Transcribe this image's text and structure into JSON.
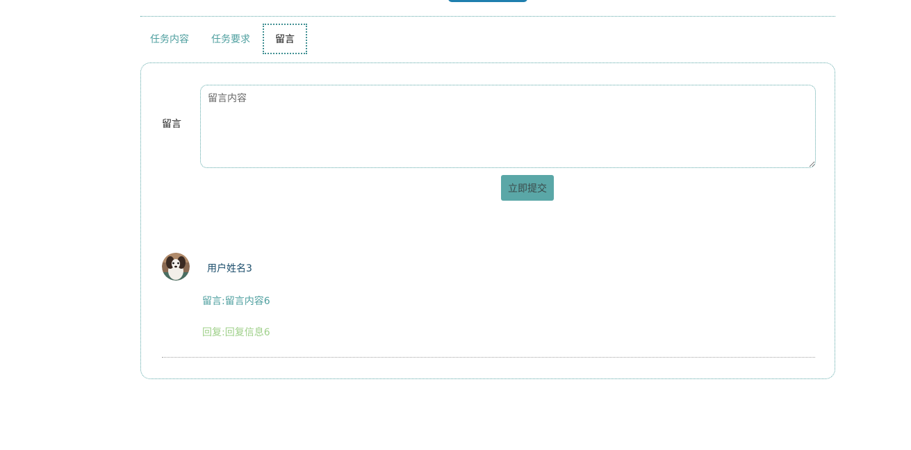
{
  "tabs": [
    {
      "label": "任务内容"
    },
    {
      "label": "任务要求"
    },
    {
      "label": "留言"
    }
  ],
  "form": {
    "label": "留言",
    "textarea_placeholder": "留言内容",
    "textarea_value": "",
    "submit_label": "立即提交"
  },
  "comments": [
    {
      "user_name": "用户姓名3",
      "message": "留言:留言内容6",
      "reply": "回复:回复信息6"
    }
  ],
  "colors": {
    "accent": "#5aa7a7",
    "tab_text": "#4e9f9f",
    "reply_text": "#9fd08a",
    "user_name": "#1c4e6c",
    "top_button": "#1f7fae"
  },
  "icons": {
    "avatar": "dog-avatar-icon"
  }
}
